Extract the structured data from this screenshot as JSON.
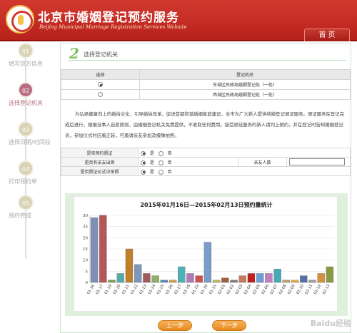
{
  "header": {
    "title": "北京市婚姻登记预约服务",
    "subtitle": "Beijing Municipal Marriage Registration Services Website",
    "home_label": "首 页"
  },
  "steps": [
    {
      "num": "01",
      "label": "填写双方信息",
      "active": false
    },
    {
      "num": "02",
      "label": "选择登记机关",
      "active": true
    },
    {
      "num": "03",
      "label": "选择日期/时间段",
      "active": false
    },
    {
      "num": "04",
      "label": "打印预约单",
      "active": false
    },
    {
      "num": "05",
      "label": "预约完成",
      "active": false
    }
  ],
  "section": {
    "num": "2",
    "title": "选择登记机关"
  },
  "org_table": {
    "col_select": "选择",
    "col_org": "登记机关",
    "rows": [
      {
        "name": "东城区民政局婚姻登记处（一处）",
        "selected": true
      },
      {
        "name": "西城区民政局婚姻登记处（一处）",
        "selected": false
      }
    ]
  },
  "notice": "为弘扬健康向上的婚俗文化，引导婚俗改革，促进首都和谐婚姻家庭建设，全市为广大新人提供结婚登记颁证服务。颁证服务在登记完成后进行，婚姻当事人自愿原则，由婚姻登记机关免费提供，不收取任何费用。接受颁证服务的新人请同上预约，并在登记时告知婚姻登记员，参加仪式时应着正装，可邀请亲友参加及摄像拍照。",
  "options": [
    {
      "label": "是否预约颁证",
      "yes": "是",
      "no": "否",
      "yes_selected": true,
      "extra_label": "",
      "extra_input": false
    },
    {
      "label": "是否有亲友出席",
      "yes": "是",
      "no": "否",
      "yes_selected": true,
      "extra_label": "亲友人数",
      "extra_input": true
    },
    {
      "label": "是否颁证仪式中拍照",
      "yes": "是",
      "no": "否",
      "yes_selected": true,
      "extra_label": "",
      "extra_input": false
    }
  ],
  "nav": {
    "prev": "上一步",
    "next": "下一步"
  },
  "watermark": "Baidu经验",
  "chart_data": {
    "type": "bar",
    "title": "2015年01月16日—2015年02月13日预约量统计",
    "ylim": [
      0,
      30
    ],
    "yticks": [
      0,
      5,
      10,
      15,
      20,
      25,
      30
    ],
    "grid": true,
    "categories": [
      "01-16",
      "01-17",
      "01-19",
      "01-20",
      "01-21",
      "01-22",
      "01-23",
      "01-24",
      "01-25",
      "01-26",
      "01-27",
      "01-28",
      "01-29",
      "01-30",
      "01-31",
      "02-01",
      "02-02",
      "02-03",
      "02-04",
      "02-05",
      "02-06",
      "02-07",
      "02-08",
      "02-09",
      "02-10",
      "02-11",
      "02-12",
      "02-13"
    ],
    "values": [
      29,
      30,
      1,
      4,
      15,
      8,
      4,
      3,
      1,
      1,
      7,
      4,
      3,
      18,
      1,
      2,
      1,
      3,
      4,
      4,
      4,
      6,
      1,
      1,
      3,
      1,
      4,
      7
    ],
    "colors": [
      "#7f8fb8",
      "#b35757",
      "#7fa05a",
      "#5aa9a9",
      "#c07f2a",
      "#7c98ba",
      "#a05a5a",
      "#8fae6a",
      "#5a88b8",
      "#d4a050",
      "#4fb0b8",
      "#b07ab8",
      "#d05050",
      "#7b9cc8",
      "#b8b85a",
      "#a06040",
      "#808080",
      "#c87858",
      "#c02020",
      "#6aa0d8",
      "#c080c0",
      "#4aa8b8",
      "#c0a070",
      "#e0b040",
      "#5870a8",
      "#a0a0a0",
      "#d89040",
      "#8a9a40"
    ]
  }
}
